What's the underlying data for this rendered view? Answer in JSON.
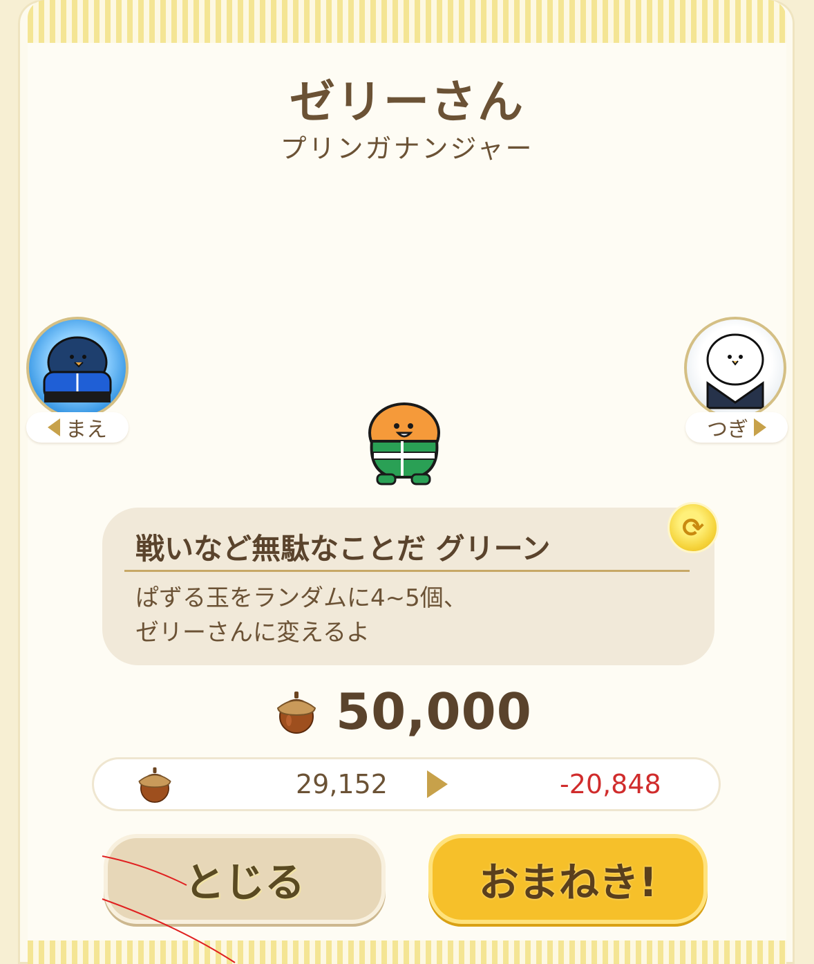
{
  "character": {
    "name": "ゼリーさん",
    "series": "プリンガナンジャー"
  },
  "navigation": {
    "prev_label": "まえ",
    "next_label": "つぎ"
  },
  "skill": {
    "name": "戦いなど無駄なことだ グリーン",
    "description_line1": "ぱずる玉をランダムに4~5個、",
    "description_line2": "ゼリーさんに変えるよ"
  },
  "price": {
    "currency_icon": "acorn-icon",
    "value": "50,000"
  },
  "balance": {
    "current": "29,152",
    "difference": "-20,848"
  },
  "buttons": {
    "close_label": "とじる",
    "invite_label": "おまねき!"
  },
  "colors": {
    "text_brown": "#6b5235",
    "stripe_yellow": "#f4e594",
    "invite_button": "#f6c02a",
    "close_button": "#e7d7b8",
    "negative_red": "#d02c2c"
  }
}
